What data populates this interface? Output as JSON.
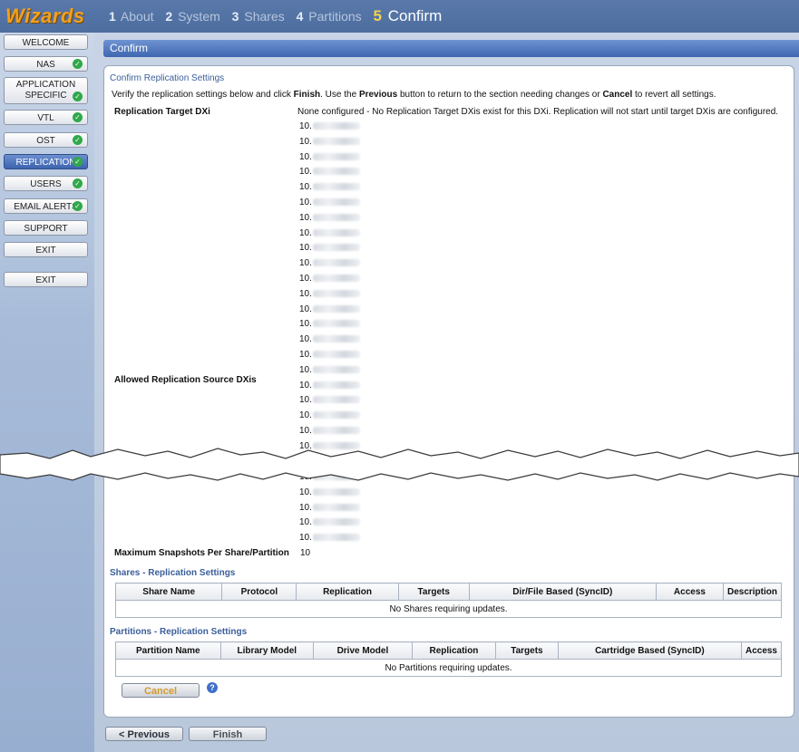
{
  "brand": "Wizards",
  "steps": [
    {
      "num": "1",
      "label": "About"
    },
    {
      "num": "2",
      "label": "System"
    },
    {
      "num": "3",
      "label": "Shares"
    },
    {
      "num": "4",
      "label": "Partitions"
    },
    {
      "num": "5",
      "label": "Confirm"
    }
  ],
  "sidebar": {
    "welcome": "WELCOME",
    "nas": "NAS",
    "app_line1": "APPLICATION",
    "app_line2": "SPECIFIC",
    "vtl": "VTL",
    "ost": "OST",
    "replication": "REPLICATION",
    "users": "USERS",
    "email_alerts": "EMAIL ALERTS",
    "support": "SUPPORT",
    "exit1": "EXIT",
    "exit2": "EXIT",
    "check": "✓"
  },
  "main": {
    "header": "Confirm",
    "section_title": "Confirm Replication Settings",
    "intro": {
      "p1": "Verify the replication settings below and click ",
      "b1": "Finish",
      "p2": ". Use the ",
      "b2": "Previous",
      "p3": " button to return to the section needing changes or ",
      "b3": "Cancel",
      "p4": " to revert all settings."
    },
    "target_label": "Replication Target DXi",
    "target_value": "None configured - No Replication Target DXis exist for this DXi. Replication will not start until target DXis are configured.",
    "source_label": "Allowed Replication Source DXis",
    "ip_prefix": "10.",
    "max_label": "Maximum Snapshots Per Share/Partition",
    "max_value": "10",
    "shares_title": "Shares - Replication Settings",
    "shares_cols": [
      "Share Name",
      "Protocol",
      "Replication",
      "Targets",
      "Dir/File Based (SyncID)",
      "Access",
      "Description"
    ],
    "shares_empty": "No Shares requiring updates.",
    "partitions_title": "Partitions - Replication Settings",
    "partitions_cols": [
      "Partition Name",
      "Library Model",
      "Drive Model",
      "Replication",
      "Targets",
      "Cartridge Based (SyncID)",
      "Access"
    ],
    "partitions_empty": "No Partitions requiring updates."
  },
  "buttons": {
    "cancel": "Cancel",
    "help": "?",
    "previous": "< Previous",
    "finish": "Finish"
  }
}
